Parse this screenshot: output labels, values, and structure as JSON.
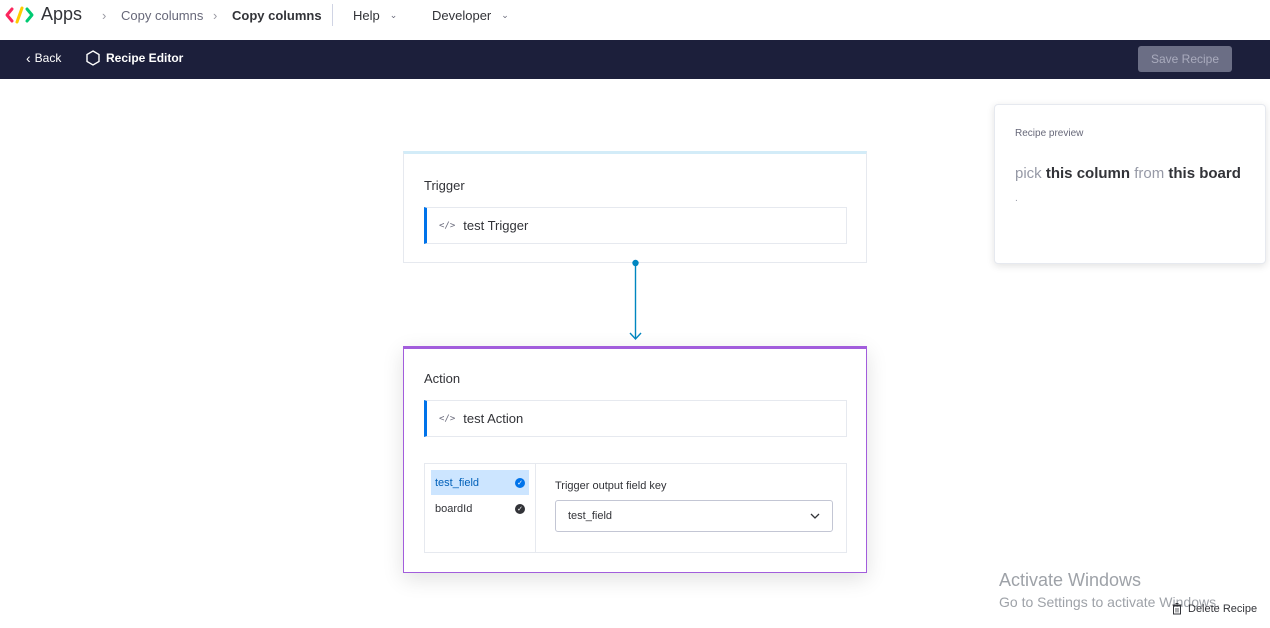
{
  "topbar": {
    "app_name": "Apps",
    "breadcrumbs": [
      "Copy columns",
      "Copy columns"
    ],
    "menus": [
      "Help",
      "Developer"
    ]
  },
  "navbar": {
    "back_label": "Back",
    "title": "Recipe Editor",
    "save_label": "Save Recipe"
  },
  "trigger": {
    "heading": "Trigger",
    "name": "test Trigger"
  },
  "action": {
    "heading": "Action",
    "name": "test Action",
    "fields": [
      {
        "label": "test_field"
      },
      {
        "label": "boardId"
      }
    ],
    "detail_label": "Trigger output field key",
    "selected_value": "test_field"
  },
  "preview": {
    "label": "Recipe preview",
    "parts": [
      "pick",
      "this column",
      "from",
      "this board"
    ],
    "trailing": "."
  },
  "watermark": {
    "title": "Activate Windows",
    "subtitle": "Go to Settings to activate Windows."
  },
  "footer": {
    "delete_label": "Delete Recipe"
  },
  "colors": {
    "navbar_bg": "#1c1f3b",
    "accent_blue": "#0073ea",
    "action_border": "#a25ddc"
  }
}
